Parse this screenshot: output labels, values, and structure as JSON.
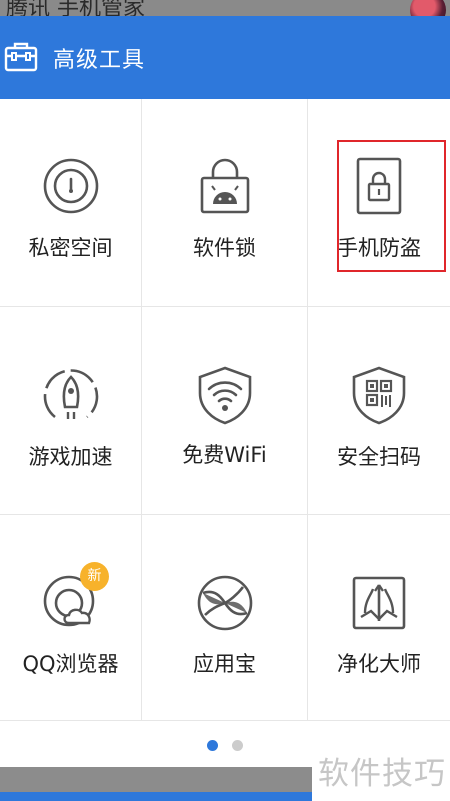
{
  "status_bar": {
    "app_title": "腾讯 手机管家"
  },
  "header": {
    "title": "高级工具",
    "icon": "toolbox-icon",
    "bg_color": "#2e78db"
  },
  "tools": [
    {
      "label": "私密空间",
      "icon": "private-space-icon"
    },
    {
      "label": "软件锁",
      "icon": "app-lock-icon"
    },
    {
      "label": "手机防盗",
      "icon": "anti-theft-icon",
      "highlighted": true
    },
    {
      "label": "游戏加速",
      "icon": "rocket-icon"
    },
    {
      "label": "免费WiFi",
      "icon": "wifi-shield-icon"
    },
    {
      "label": "安全扫码",
      "icon": "qr-shield-icon"
    },
    {
      "label": "QQ浏览器",
      "icon": "browser-icon",
      "badge": "新"
    },
    {
      "label": "应用宝",
      "icon": "app-store-icon"
    },
    {
      "label": "净化大师",
      "icon": "purify-icon"
    }
  ],
  "pager": {
    "page_count": 2,
    "active_page": 1,
    "active_color": "#2e78db",
    "inactive_color": "#cccccc"
  },
  "watermark": "软件技巧"
}
